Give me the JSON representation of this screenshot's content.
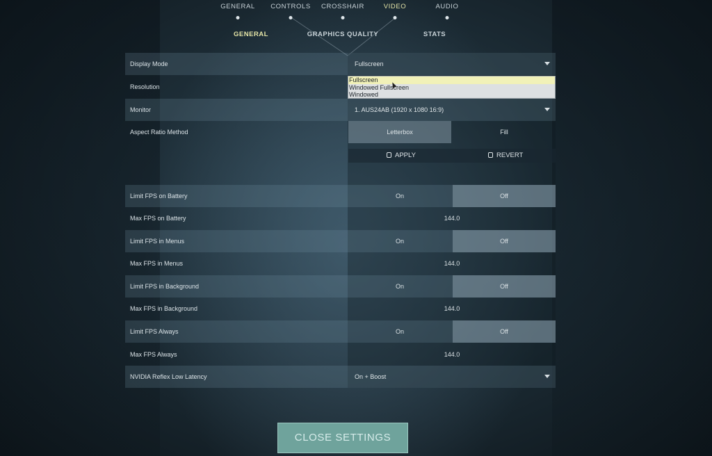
{
  "top_tabs": [
    {
      "label": "GENERAL",
      "active": false
    },
    {
      "label": "CONTROLS",
      "active": false
    },
    {
      "label": "CROSSHAIR",
      "active": false
    },
    {
      "label": "VIDEO",
      "active": true
    },
    {
      "label": "AUDIO",
      "active": false
    }
  ],
  "sub_tabs": [
    {
      "label": "GENERAL",
      "active": true
    },
    {
      "label": "GRAPHICS QUALITY",
      "active": false
    },
    {
      "label": "STATS",
      "active": false
    }
  ],
  "settings": {
    "display_mode": {
      "label": "Display Mode",
      "value": "Fullscreen"
    },
    "resolution": {
      "label": "Resolution"
    },
    "monitor": {
      "label": "Monitor",
      "value": "1. AUS24AB (1920 x  1080 16:9)"
    },
    "aspect_ratio": {
      "label": "Aspect Ratio Method",
      "option_a": "Letterbox",
      "option_b": "Fill",
      "selected": "Letterbox"
    },
    "apply_label": "APPLY",
    "revert_label": "REVERT",
    "limit_fps_battery": {
      "label": "Limit FPS on Battery",
      "on": "On",
      "off": "Off",
      "selected": "Off"
    },
    "max_fps_battery": {
      "label": "Max FPS on Battery",
      "value": "144.0"
    },
    "limit_fps_menus": {
      "label": "Limit FPS in Menus",
      "on": "On",
      "off": "Off",
      "selected": "Off"
    },
    "max_fps_menus": {
      "label": "Max FPS in Menus",
      "value": "144.0"
    },
    "limit_fps_background": {
      "label": "Limit FPS in Background",
      "on": "On",
      "off": "Off",
      "selected": "Off"
    },
    "max_fps_background": {
      "label": "Max FPS in Background",
      "value": "144.0"
    },
    "limit_fps_always": {
      "label": "Limit FPS Always",
      "on": "On",
      "off": "Off",
      "selected": "Off"
    },
    "max_fps_always": {
      "label": "Max FPS Always",
      "value": "144.0"
    },
    "nvidia_reflex": {
      "label": "NVIDIA Reflex Low Latency",
      "value": "On + Boost"
    }
  },
  "dropdown_options": [
    {
      "label": "Fullscreen",
      "highlighted": true
    },
    {
      "label": "Windowed Fullscreen",
      "highlighted": false
    },
    {
      "label": "Windowed",
      "highlighted": false
    }
  ],
  "close_button": "CLOSE SETTINGS"
}
